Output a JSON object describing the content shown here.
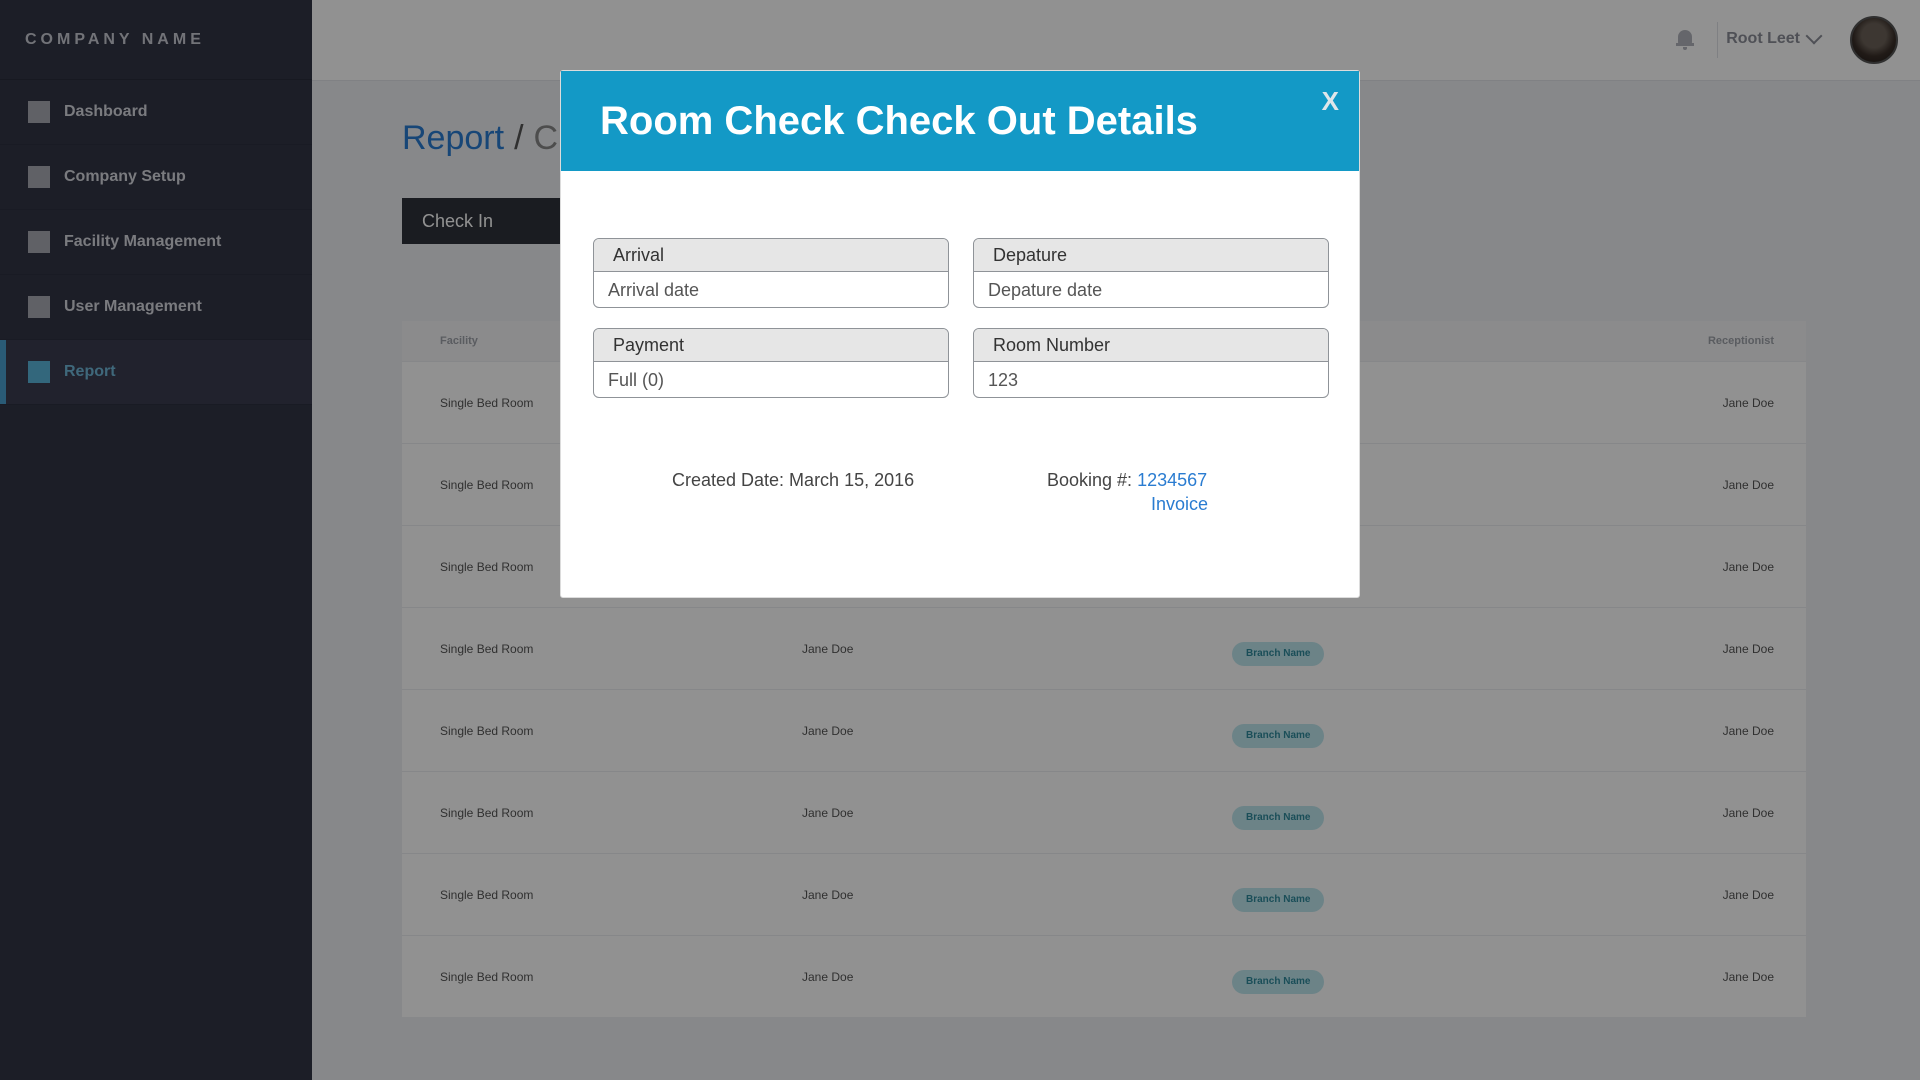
{
  "brand": "COMPANY NAME",
  "sidebar": {
    "items": [
      {
        "label": "Dashboard"
      },
      {
        "label": "Company Setup"
      },
      {
        "label": "Facility Management"
      },
      {
        "label": "User Management"
      },
      {
        "label": "Report"
      }
    ]
  },
  "topbar": {
    "user_name": "Root Leet"
  },
  "breadcrumb": {
    "parent": "Report",
    "separator": "/",
    "current": "Ch"
  },
  "tab": {
    "label": "Check In"
  },
  "table": {
    "headers": {
      "facility": "Facility",
      "receptionist": "Receptionist"
    },
    "rows": [
      {
        "facility": "Single Bed Room",
        "guest": "",
        "branch": "",
        "receptionist": "Jane Doe"
      },
      {
        "facility": "Single Bed Room",
        "guest": "",
        "branch": "",
        "receptionist": "Jane Doe"
      },
      {
        "facility": "Single Bed Room",
        "guest": "",
        "branch": "",
        "receptionist": "Jane Doe"
      },
      {
        "facility": "Single Bed Room",
        "guest": "Jane Doe",
        "branch": "Branch Name",
        "receptionist": "Jane Doe"
      },
      {
        "facility": "Single Bed Room",
        "guest": "Jane Doe",
        "branch": "Branch Name",
        "receptionist": "Jane Doe"
      },
      {
        "facility": "Single Bed Room",
        "guest": "Jane Doe",
        "branch": "Branch Name",
        "receptionist": "Jane Doe"
      },
      {
        "facility": "Single Bed Room",
        "guest": "Jane Doe",
        "branch": "Branch Name",
        "receptionist": "Jane Doe"
      },
      {
        "facility": "Single Bed Room",
        "guest": "Jane Doe",
        "branch": "Branch Name",
        "receptionist": "Jane Doe"
      }
    ]
  },
  "modal": {
    "title": "Room Check Check Out Details",
    "close": "X",
    "arrival": {
      "label": "Arrival",
      "value": "Arrival date"
    },
    "departure": {
      "label": "Depature",
      "value": "Depature date"
    },
    "payment": {
      "label": "Payment",
      "value": "Full (0)"
    },
    "room_number": {
      "label": "Room Number",
      "value": "123"
    },
    "created": "Created Date: March 15, 2016",
    "booking_label": "Booking #:",
    "booking_number": "1234567",
    "invoice": "Invoice"
  },
  "colors": {
    "sidebar_bg": "#323545",
    "modal_header": "#1399c6",
    "link": "#2a7cd1",
    "active_nav": "#6fb7d8"
  }
}
